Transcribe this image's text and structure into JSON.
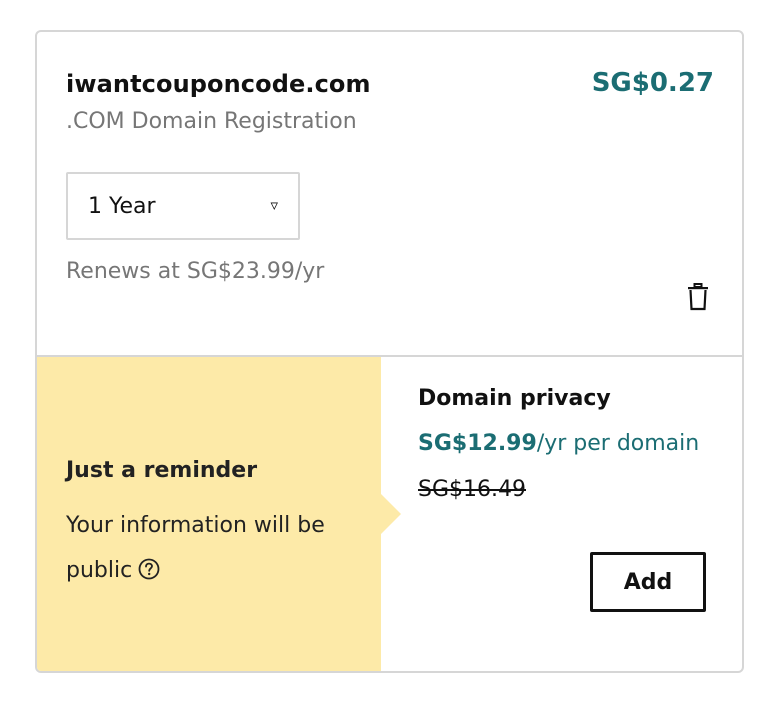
{
  "item": {
    "domain": "iwantcouponcode.com",
    "price": "SG$0.27",
    "product": ".COM Domain Registration",
    "term": {
      "selected": "1 Year",
      "caret_icon": "caret-down-icon"
    },
    "renews": "Renews at SG$23.99/yr",
    "delete_icon": "trash-icon"
  },
  "reminder": {
    "title": "Just a reminder",
    "text": "Your information will be public",
    "help_icon": "question-circle-icon"
  },
  "privacy": {
    "title": "Domain privacy",
    "price": "SG$12.99",
    "price_suffix": "/yr per domain",
    "old_price": "SG$16.49",
    "add_label": "Add"
  },
  "colors": {
    "accent": "#1b6d73",
    "reminder_bg": "#fdeaa8",
    "muted_text": "#767676",
    "border": "#d6d6d6"
  }
}
